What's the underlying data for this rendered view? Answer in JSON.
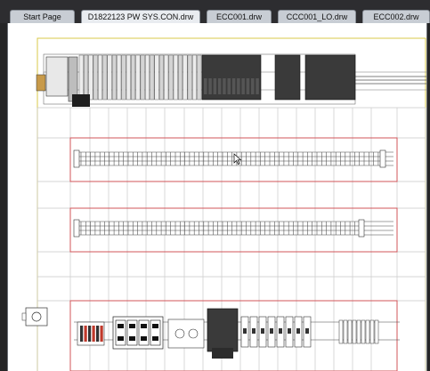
{
  "tabs": [
    {
      "label": "Start Page",
      "active": false
    },
    {
      "label": "D1822123 PW SYS.CON.drw",
      "active": true
    },
    {
      "label": "ECC001.drw",
      "active": false
    },
    {
      "label": "CCC001_LO.drw",
      "active": false
    },
    {
      "label": "ECC002.drw",
      "active": false
    }
  ],
  "colors": {
    "app_background": "#252526",
    "canvas_background": "#ffffff",
    "border_yellow": "#d9c84a",
    "rail_red": "#d2555a",
    "grid_gray": "#c9c9c9",
    "device_dark": "#2b2b2b"
  },
  "icons": {
    "cursor": "mouse-pointer-icon"
  }
}
